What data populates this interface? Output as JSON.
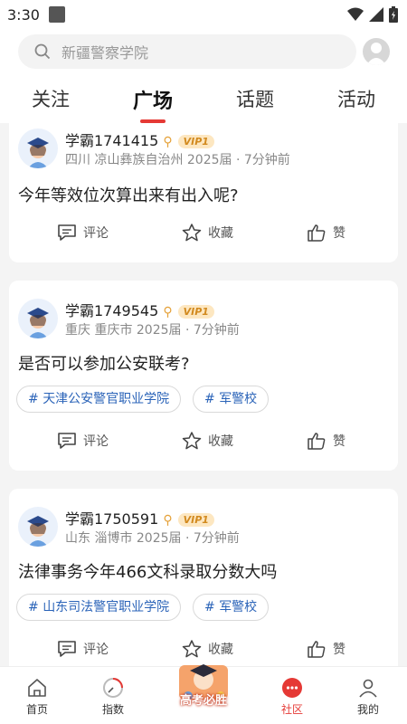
{
  "status": {
    "time": "3:30"
  },
  "search": {
    "placeholder": "新疆警察学院"
  },
  "tabs": [
    {
      "label": "关注"
    },
    {
      "label": "广场"
    },
    {
      "label": "话题"
    },
    {
      "label": "活动"
    }
  ],
  "posts": [
    {
      "user": "学霸1741415",
      "vip": "VIP1",
      "meta": "四川 凉山彝族自治州 2025届 · 7分钟前",
      "text": "今年等效位次算出来有出入呢?",
      "tags": []
    },
    {
      "user": "学霸1749545",
      "vip": "VIP1",
      "meta": "重庆 重庆市 2025届 · 7分钟前",
      "text": "是否可以参加公安联考?",
      "tags": [
        "天津公安警官职业学院",
        "军警校"
      ]
    },
    {
      "user": "学霸1750591",
      "vip": "VIP1",
      "meta": "山东 淄博市 2025届 · 7分钟前",
      "text": "法律事务今年466文科录取分数大吗",
      "tags": [
        "山东司法警官职业学院",
        "军警校"
      ]
    }
  ],
  "actions": {
    "comment": "评论",
    "favorite": "收藏",
    "like": "赞"
  },
  "nav": [
    {
      "label": "首页"
    },
    {
      "label": "指数"
    },
    {
      "label": "高考必胜"
    },
    {
      "label": "社区"
    },
    {
      "label": "我的"
    }
  ],
  "colors": {
    "accent": "#e53935",
    "tag_text": "#2a63b8",
    "vip_bg": "#fde7c1"
  }
}
